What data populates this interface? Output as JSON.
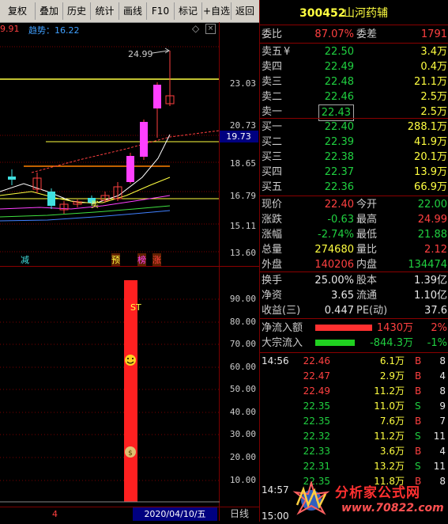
{
  "toolbar": {
    "buttons": [
      "复权",
      "叠加",
      "历史",
      "统计",
      "画线",
      "F10",
      "标记",
      "+自选",
      "返回"
    ]
  },
  "chart": {
    "top_left_value": "9.91",
    "indicator_label": "趋势：16.22",
    "callout_value": "24.99",
    "y_labels": [
      "23.03",
      "20.73",
      "18.65",
      "16.79",
      "15.11",
      "13.60"
    ],
    "current_price_marker": "19.73",
    "markers": {
      "left": "减",
      "m1": "预",
      "m2": "榜",
      "m3": "涨"
    },
    "buy_marker": "买",
    "lower_y_labels": [
      "90.00",
      "80.00",
      "70.00",
      "60.00",
      "50.00",
      "40.00",
      "30.00",
      "20.00",
      "10.00"
    ],
    "st_label": "ST",
    "date_label": "2020/04/10/五",
    "period_label": "日线",
    "left_status_digit": "4"
  },
  "panel": {
    "code": "300452",
    "name": "山河药辅",
    "webi_label": "委比",
    "webi_value": "87.07%",
    "weicha_label": "委差",
    "weicha_value": "1791",
    "asks": [
      {
        "label": "卖五",
        "mark": "¥",
        "price": "22.50",
        "vol": "3.4万"
      },
      {
        "label": "卖四",
        "mark": "",
        "price": "22.49",
        "vol": "0.4万"
      },
      {
        "label": "卖三",
        "mark": "",
        "price": "22.48",
        "vol": "21.1万"
      },
      {
        "label": "卖二",
        "mark": "",
        "price": "22.46",
        "vol": "2.5万"
      },
      {
        "label": "卖一",
        "mark": "",
        "price": "22.43",
        "vol": "2.5万"
      }
    ],
    "bids": [
      {
        "label": "买一",
        "price": "22.40",
        "vol": "288.1万"
      },
      {
        "label": "买二",
        "price": "22.39",
        "vol": "41.9万"
      },
      {
        "label": "买三",
        "price": "22.38",
        "vol": "20.1万"
      },
      {
        "label": "买四",
        "price": "22.37",
        "vol": "13.9万"
      },
      {
        "label": "买五",
        "price": "22.36",
        "vol": "66.9万"
      }
    ],
    "quote": [
      {
        "l1": "现价",
        "v1": "22.40",
        "c1": "red",
        "l2": "今开",
        "v2": "22.00",
        "c2": "green"
      },
      {
        "l1": "涨跌",
        "v1": "-0.63",
        "c1": "green",
        "l2": "最高",
        "v2": "24.99",
        "c2": "red"
      },
      {
        "l1": "涨幅",
        "v1": "-2.74%",
        "c1": "green",
        "l2": "最低",
        "v2": "21.88",
        "c2": "green"
      },
      {
        "l1": "总量",
        "v1": "274680",
        "c1": "yellow",
        "l2": "量比",
        "v2": "2.12",
        "c2": "red"
      },
      {
        "l1": "外盘",
        "v1": "140206",
        "c1": "red",
        "l2": "内盘",
        "v2": "134474",
        "c2": "green"
      }
    ],
    "stats": [
      {
        "l1": "换手",
        "v1": "25.00%",
        "l2": "股本",
        "v2": "1.39亿"
      },
      {
        "l1": "净资",
        "v1": "3.65",
        "l2": "流通",
        "v2": "1.10亿"
      },
      {
        "l1": "收益(三)",
        "v1": "0.447",
        "l2": "PE(动)",
        "v2": "37.6"
      }
    ],
    "flows": [
      {
        "label": "净流入额",
        "value": "1430万",
        "pct": "2%",
        "color": "#ff3030",
        "fraction": 0.65
      },
      {
        "label": "大宗流入",
        "value": "-844.3万",
        "pct": "-1%",
        "color": "#20d020",
        "fraction": 0.45
      }
    ],
    "ticks": [
      {
        "time": "14:56",
        "price": "22.46",
        "pc": "red",
        "vol": "6.1万",
        "side": "B",
        "n": "8"
      },
      {
        "time": "",
        "price": "22.47",
        "pc": "red",
        "vol": "2.9万",
        "side": "B",
        "n": "4"
      },
      {
        "time": "",
        "price": "22.49",
        "pc": "red",
        "vol": "11.2万",
        "side": "B",
        "n": "8"
      },
      {
        "time": "",
        "price": "22.35",
        "pc": "green",
        "vol": "11.0万",
        "side": "S",
        "n": "9"
      },
      {
        "time": "",
        "price": "22.35",
        "pc": "green",
        "vol": "7.6万",
        "side": "B",
        "n": "7"
      },
      {
        "time": "",
        "price": "22.32",
        "pc": "green",
        "vol": "11.2万",
        "side": "S",
        "n": "11"
      },
      {
        "time": "",
        "price": "22.33",
        "pc": "green",
        "vol": "3.6万",
        "side": "B",
        "n": "4"
      },
      {
        "time": "",
        "price": "22.31",
        "pc": "green",
        "vol": "13.2万",
        "side": "S",
        "n": "11"
      },
      {
        "time": "",
        "price": "22.35",
        "pc": "green",
        "vol": "11.8万",
        "side": "B",
        "n": "8"
      },
      {
        "time": "14:57",
        "price": "",
        "pc": "white",
        "vol": "",
        "side": "",
        "n": ""
      },
      {
        "time": "15:00",
        "price": "",
        "pc": "white",
        "vol": "",
        "side": "",
        "n": ""
      }
    ]
  },
  "watermark": {
    "title": "分析家公式网",
    "url": "www.70822.com"
  },
  "colors": {
    "up": "#ff4040",
    "down": "#20d040",
    "accent_yellow": "#ffff40",
    "bg": "#000000",
    "grid": "#7a0000"
  }
}
